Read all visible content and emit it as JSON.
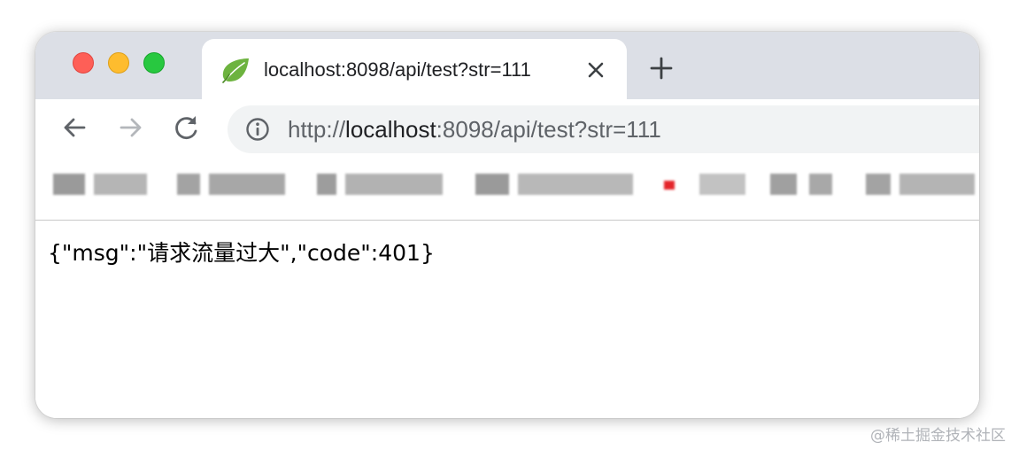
{
  "tab": {
    "title": "localhost:8098/api/test?str=111",
    "favicon": "spring-leaf-icon",
    "close_icon": "close-icon",
    "new_tab_icon": "plus-icon"
  },
  "toolbar": {
    "back_icon": "arrow-left-icon",
    "forward_icon": "arrow-right-icon",
    "reload_icon": "reload-icon",
    "info_icon": "info-circle-icon",
    "url_prefix": "http://",
    "url_host": "localhost",
    "url_rest": ":8098/api/test?str=111"
  },
  "content": {
    "body_text": "{\"msg\":\"请求流量过大\",\"code\":401}"
  },
  "watermark": "@稀土掘金技术社区",
  "colors": {
    "tabbar_bg": "#dcdfe6",
    "omnibox_bg": "#f1f3f4",
    "traffic_close": "#fe5f57",
    "traffic_minimize": "#febc2e",
    "traffic_maximize": "#28c840"
  }
}
